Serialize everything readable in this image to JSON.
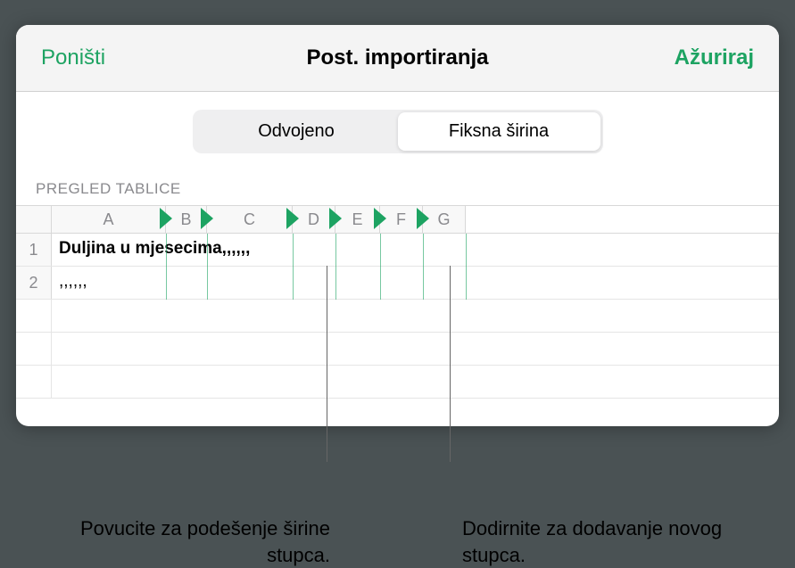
{
  "header": {
    "cancel": "Poništi",
    "title": "Post. importiranja",
    "confirm": "Ažuriraj"
  },
  "segmented": {
    "delimited": "Odvojeno",
    "fixed": "Fiksna širina"
  },
  "section_label": "PREGLED TABLICE",
  "columns": [
    {
      "letter": "A",
      "width": 128,
      "marker": false
    },
    {
      "letter": "B",
      "width": 46,
      "marker": true
    },
    {
      "letter": "C",
      "width": 96,
      "marker": true
    },
    {
      "letter": "D",
      "width": 48,
      "marker": true
    },
    {
      "letter": "E",
      "width": 50,
      "marker": true
    },
    {
      "letter": "F",
      "width": 48,
      "marker": true
    },
    {
      "letter": "G",
      "width": 48,
      "marker": true
    }
  ],
  "rows": [
    {
      "num": "1",
      "text": "Duljina u mjesecima,,,,,,",
      "bold": true
    },
    {
      "num": "2",
      "text": ",,,,,,",
      "bold": false
    }
  ],
  "callouts": {
    "left": "Povucite za podešenje širine stupca.",
    "right": "Dodirnite za dodavanje novog stupca."
  }
}
